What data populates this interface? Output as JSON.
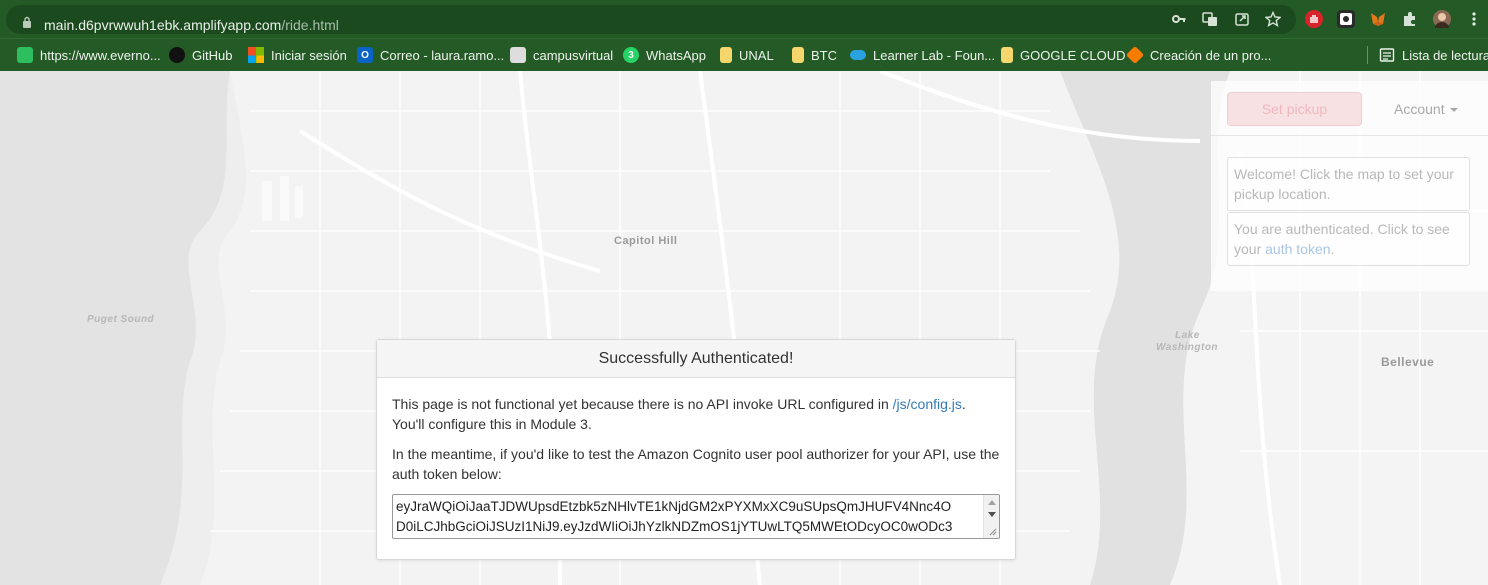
{
  "browser": {
    "url_host": "main.d6pvrwwuh1ebk.amplifyapp.com",
    "url_path": "/ride.html",
    "icons": [
      "key-icon",
      "translate-icon",
      "share-icon",
      "star-icon",
      "more-icon"
    ],
    "extensions": [
      "hand-extension-icon",
      "camera-extension-icon",
      "metamask-icon",
      "puzzle-icon",
      "profile-avatar"
    ]
  },
  "bookmarks": [
    {
      "label": "https://www.everno...",
      "icon": "evernote-icon",
      "color": "#2dbe60"
    },
    {
      "label": "GitHub",
      "icon": "github-icon",
      "color": "#111111"
    },
    {
      "label": "Iniciar sesión",
      "icon": "microsoft-icon",
      "color": "#f25022"
    },
    {
      "label": "Correo - laura.ramo...",
      "icon": "outlook-icon",
      "color": "#0a64c8"
    },
    {
      "label": "campusvirtual",
      "icon": "campusvirtual-icon",
      "color": "#dddddd"
    },
    {
      "label": "WhatsApp",
      "icon": "whatsapp-icon",
      "color": "#25d366"
    },
    {
      "label": "UNAL",
      "icon": "folder-icon",
      "color": "#f5d76e"
    },
    {
      "label": "BTC",
      "icon": "folder-icon",
      "color": "#f5d76e"
    },
    {
      "label": "Learner Lab - Foun...",
      "icon": "cloud-icon",
      "color": "#29a3e0"
    },
    {
      "label": "GOOGLE CLOUD",
      "icon": "folder-icon",
      "color": "#f5d76e"
    },
    {
      "label": "Creación de un pro...",
      "icon": "box-icon",
      "color": "#f57c00"
    }
  ],
  "whatsapp_badge": "3",
  "reading_list_label": "Lista de lectura",
  "map": {
    "labels": {
      "capitol_hill": "Capitol Hill",
      "puget_sound": "Puget Sound",
      "lake_washington_1": "Lake",
      "lake_washington_2": "Washington",
      "bellevue": "Bellevue"
    }
  },
  "panel": {
    "set_pickup_label": "Set pickup",
    "account_label": "Account",
    "welcome_message": "Welcome! Click the map to set your pickup location.",
    "auth_message_prefix": "You are authenticated. Click to see your ",
    "auth_link": "auth token",
    "auth_message_suffix": "."
  },
  "modal": {
    "title": "Successfully Authenticated!",
    "p1_prefix": "This page is not functional yet because there is no API invoke URL configured in ",
    "p1_link": "/js/config.js",
    "p1_suffix": ". You'll configure this in Module 3.",
    "p2": "In the meantime, if you'd like to test the Amazon Cognito user pool authorizer for your API, use the auth token below:",
    "token_line1": "eyJraWQiOiJaaTJDWUpsdEtzbk5zNHlvTE1kNjdGM2xPYXMxXC9uSUpsQmJHUFV4Nnc4O",
    "token_line2": "D0iLCJhbGciOiJSUzI1NiJ9.eyJzdWIiOiJhYzlkNDZmOS1jYTUwLTQ5MWEtODcyOC0wODc3"
  }
}
